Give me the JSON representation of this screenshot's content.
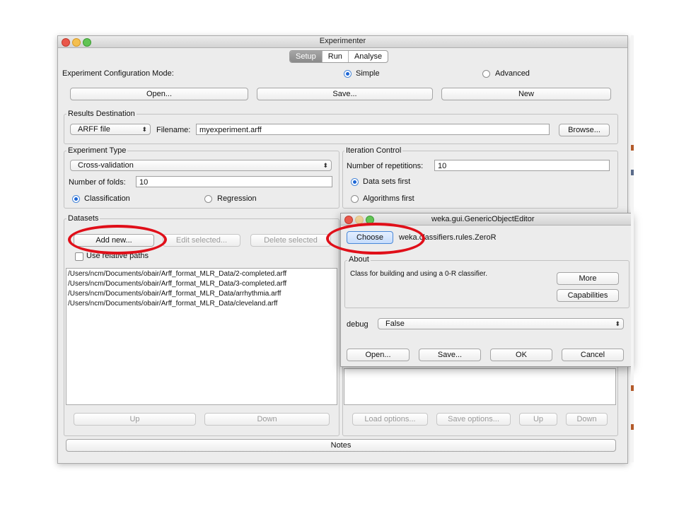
{
  "window": {
    "title": "Experimenter"
  },
  "tabs": [
    {
      "label": "Setup",
      "active": true
    },
    {
      "label": "Run"
    },
    {
      "label": "Analyse"
    }
  ],
  "config": {
    "mode_label": "Experiment Configuration Mode:",
    "simple": "Simple",
    "advanced": "Advanced",
    "selected": "Simple",
    "open": "Open...",
    "save": "Save...",
    "new": "New"
  },
  "results": {
    "legend": "Results Destination",
    "format": "ARFF file",
    "filename_label": "Filename:",
    "filename": "myexperiment.arff",
    "browse": "Browse..."
  },
  "experiment_type": {
    "legend": "Experiment Type",
    "type": "Cross-validation",
    "folds_label": "Number of folds:",
    "folds": "10",
    "classification": "Classification",
    "regression": "Regression",
    "selected": "Classification"
  },
  "iteration": {
    "legend": "Iteration Control",
    "reps_label": "Number of repetitions:",
    "reps": "10",
    "data_first": "Data sets first",
    "algo_first": "Algorithms first",
    "selected": "Data sets first"
  },
  "datasets": {
    "legend": "Datasets",
    "add": "Add new...",
    "edit": "Edit selected...",
    "delete": "Delete selected",
    "relative": "Use relative paths",
    "items": [
      "/Users/ncm/Documents/obair/Arff_format_MLR_Data/2-completed.arff",
      "/Users/ncm/Documents/obair/Arff_format_MLR_Data/3-completed.arff",
      "/Users/ncm/Documents/obair/Arff_format_MLR_Data/arrhythmia.arff",
      "/Users/ncm/Documents/obair/Arff_format_MLR_Data/cleveland.arff"
    ],
    "up": "Up",
    "down": "Down"
  },
  "algorithms": {
    "load": "Load options...",
    "save": "Save options...",
    "up": "Up",
    "down": "Down"
  },
  "notes": "Notes",
  "editor": {
    "title": "weka.gui.GenericObjectEditor",
    "choose": "Choose",
    "classname": "weka.classifiers.rules.ZeroR",
    "about_legend": "About",
    "about_text": "Class for building and using a 0-R classifier.",
    "more": "More",
    "capabilities": "Capabilities",
    "debug_label": "debug",
    "debug_value": "False",
    "open": "Open...",
    "save": "Save...",
    "ok": "OK",
    "cancel": "Cancel"
  },
  "colors": {
    "highlight": "#e00f19",
    "accent": "#1c66d6"
  }
}
